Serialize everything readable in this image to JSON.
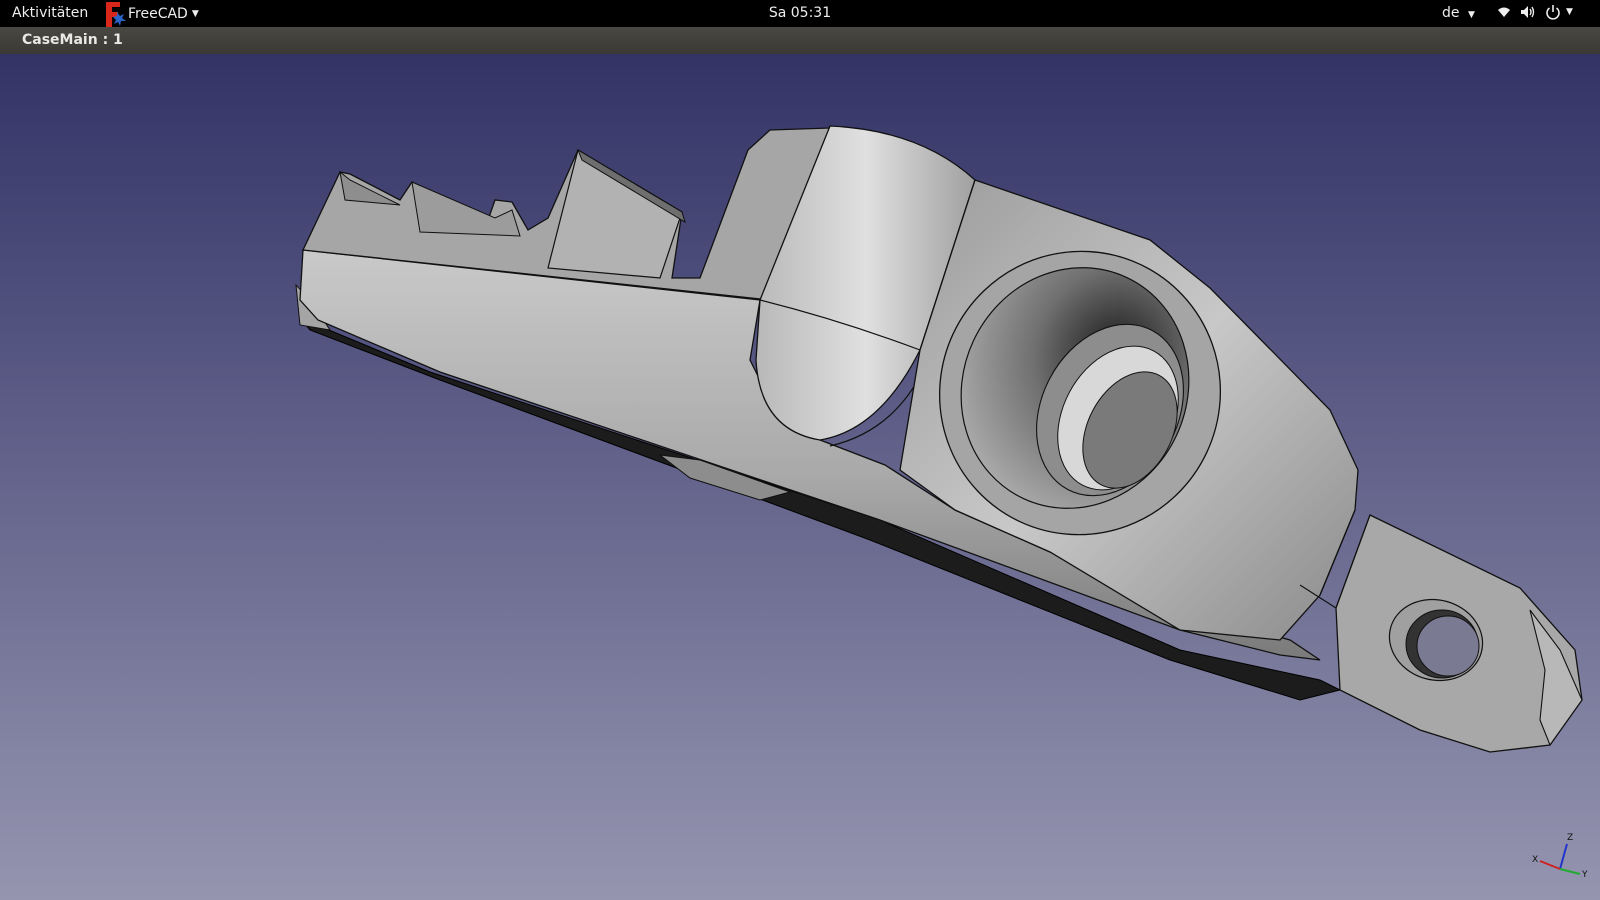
{
  "topbar": {
    "activities_label": "Aktivitäten",
    "app_name": "FreeCAD",
    "clock": "Sa 05:31",
    "language": "de",
    "icons": [
      "wifi-icon",
      "volume-icon",
      "power-icon"
    ]
  },
  "window": {
    "title": "CaseMain : 1"
  },
  "viewport": {
    "background_top": "#333366",
    "background_bottom": "#9595b0",
    "model_color": "#b0b0b0",
    "axis_labels": {
      "x": "X",
      "y": "Y",
      "z": "Z"
    }
  }
}
